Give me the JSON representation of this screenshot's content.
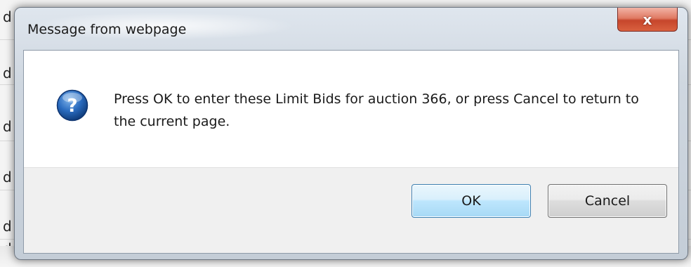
{
  "dialog": {
    "title": "Message from webpage",
    "close_label": "x",
    "message": "Press OK to enter these Limit Bids for auction 366, or press Cancel to return to the current page.",
    "icon": "question-icon",
    "ok_label": "OK",
    "cancel_label": "Cancel"
  },
  "background": {
    "edge_glyphs": [
      "d",
      "d",
      "d",
      "d",
      "d",
      "d"
    ]
  },
  "colors": {
    "close_button": "#d9613f",
    "ok_border": "#3c7fb1",
    "icon_blue": "#1d5ca8"
  }
}
